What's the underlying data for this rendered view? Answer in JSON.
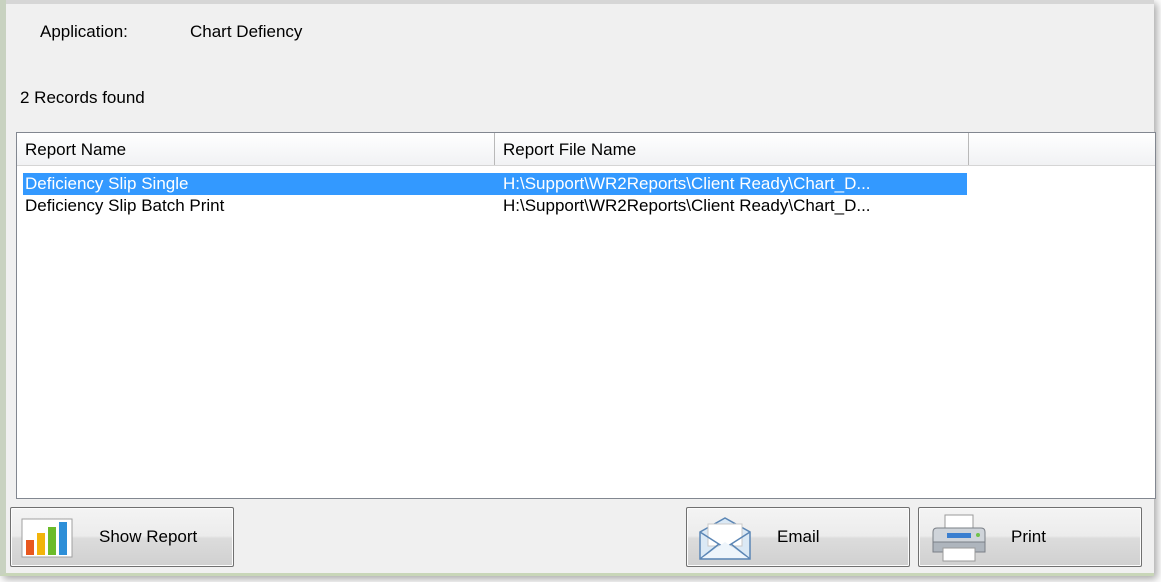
{
  "header": {
    "application_label": "Application:",
    "application_value": "Chart Defiency"
  },
  "status": {
    "records_found": "2 Records found"
  },
  "report_list": {
    "columns": [
      "Report Name",
      "Report File Name"
    ],
    "rows": [
      {
        "name": "Deficiency Slip Single",
        "file": "H:\\Support\\WR2Reports\\Client Ready\\Chart_D...",
        "selected": true
      },
      {
        "name": "Deficiency Slip Batch Print",
        "file": "H:\\Support\\WR2Reports\\Client Ready\\Chart_D...",
        "selected": false
      }
    ]
  },
  "buttons": {
    "show_report": "Show Report",
    "email": "Email",
    "print": "Print"
  },
  "icons": {
    "show_report": "bar-chart-icon",
    "email": "envelope-icon",
    "print": "printer-icon"
  },
  "colors": {
    "selection": "#3399ff",
    "window_bg": "#f0f0f0"
  }
}
